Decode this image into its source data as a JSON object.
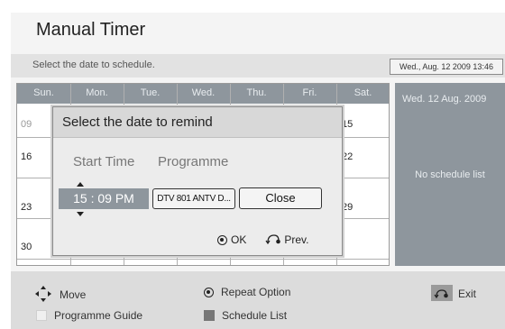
{
  "title": "Manual Timer",
  "instruction": "Select the date to schedule.",
  "current_datetime": "Wed., Aug. 12 2009 13:46",
  "calendar": {
    "days": [
      "Sun.",
      "Mon.",
      "Tue.",
      "Wed.",
      "Thu.",
      "Fri.",
      "Sat."
    ],
    "visible_dates": [
      "09",
      "15",
      "16",
      "22",
      "23",
      "29",
      "30"
    ]
  },
  "side_panel": {
    "selected_date": "Wed. 12 Aug. 2009",
    "message": "No schedule list"
  },
  "dialog": {
    "title": "Select the date to remind",
    "start_time_label": "Start Time",
    "programme_label": "Programme",
    "time_value": "15 : 09 PM",
    "programme_value": "DTV 801 ANTV D...",
    "close_label": "Close",
    "ok_label": "OK",
    "prev_label": "Prev."
  },
  "help": {
    "move": "Move",
    "repeat_option": "Repeat Option",
    "exit": "Exit",
    "programme_guide": "Programme Guide",
    "schedule_list": "Schedule List"
  }
}
